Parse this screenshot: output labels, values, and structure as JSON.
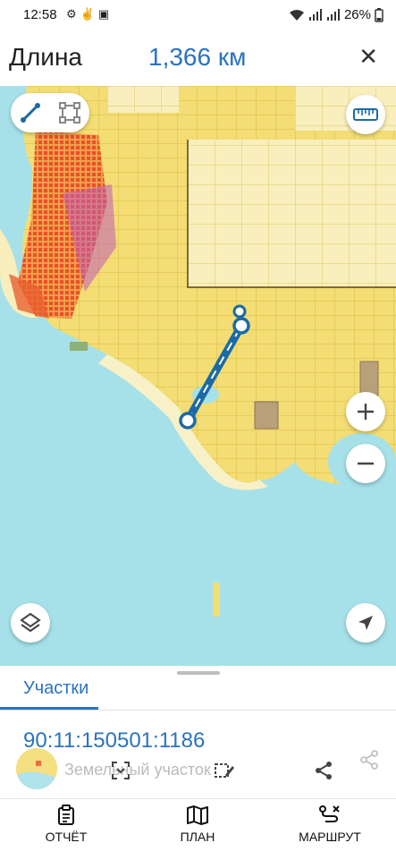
{
  "status_bar": {
    "time": "12:58",
    "battery": "26%"
  },
  "header": {
    "title": "Длина",
    "distance": "1,366 км"
  },
  "map": {
    "colors": {
      "water": "#a6e1e9",
      "land": "#f6e9a3",
      "parcel": "#f3dd74",
      "parcel_stroke": "#d8b93a",
      "dense": "#e8602f",
      "purple": "#b04ab8",
      "line": "#1b6aa5"
    },
    "icons": [
      "line-measure-icon",
      "area-measure-icon",
      "ruler-icon",
      "zoom-in-icon",
      "zoom-out-icon",
      "layers-icon",
      "location-arrow-icon"
    ]
  },
  "sheet": {
    "tab_label": "Участки",
    "cadastral_number": "90:11:150501:1186",
    "subtitle": "Земельный участок"
  },
  "nav": {
    "report": "ОТЧЁТ",
    "plan": "ПЛАН",
    "route": "МАРШРУТ"
  }
}
